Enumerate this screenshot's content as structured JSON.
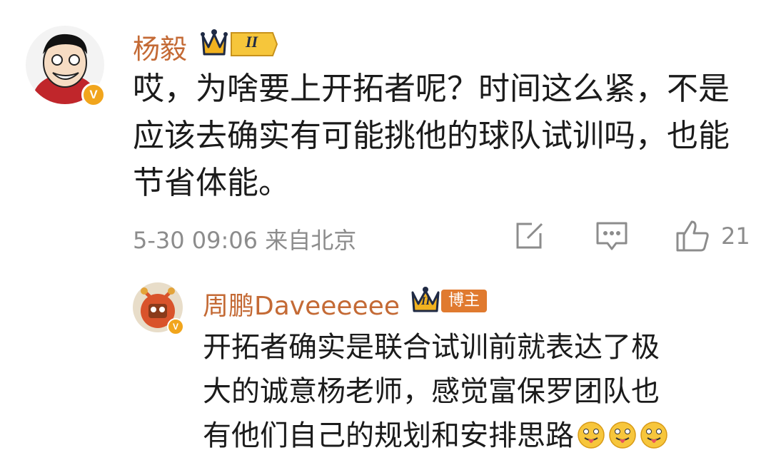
{
  "comment": {
    "author": "杨毅",
    "level_badge": "II",
    "verified_mark": "V",
    "text_lines": [
      "哎，为啥要上开拓者呢？时间这么紧，不是",
      "应该去确实有可能挑他的球队试训吗，也能",
      "节省体能。"
    ],
    "time_location": "5-30 09:06 来自北京",
    "like_count": "21",
    "icons": [
      "share-icon",
      "comment-icon",
      "like-icon"
    ]
  },
  "reply": {
    "author": "周鹏Daveeeeee",
    "level_badge": "II",
    "host_badge": "博主",
    "verified_mark": "V",
    "text_lines": [
      "开拓者确实是联合试训前就表达了极",
      "大的诚意杨老师，感觉富保罗团队也",
      "有他们自己的规划和安排思路"
    ],
    "emoji_count": 3
  },
  "colors": {
    "name": "#c46a35",
    "meta": "#8c8c8c",
    "badge_gold": "#f1a51c",
    "host_badge": "#e07a2f"
  }
}
